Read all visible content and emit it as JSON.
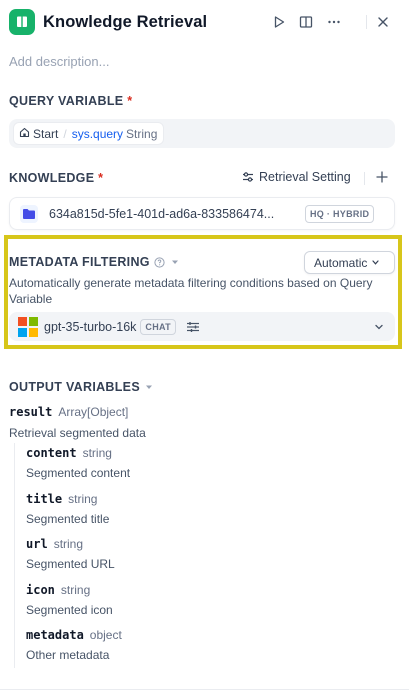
{
  "header": {
    "title": "Knowledge Retrieval",
    "icons": [
      "knowledge-book-icon",
      "play-icon",
      "split-panel-icon",
      "more-icon",
      "close-icon"
    ]
  },
  "description_placeholder": "Add description...",
  "query_variable": {
    "title": "QUERY VARIABLE",
    "required_mark": "*",
    "source": "Start",
    "separator": "/",
    "name": "sys.query",
    "type": "String"
  },
  "knowledge": {
    "title": "KNOWLEDGE",
    "required_mark": "*",
    "retrieval_setting_label": "Retrieval Setting",
    "item": {
      "name": "634a815d-5fe1-401d-ad6a-833586474...",
      "badge": "HQ · HYBRID"
    }
  },
  "metadata_filtering": {
    "title": "METADATA FILTERING",
    "mode": "Automatic",
    "description": "Automatically generate metadata filtering conditions based on Query Variable",
    "model": {
      "name": "gpt-35-turbo-16k",
      "badge": "CHAT"
    },
    "highlight_color": "#d7c61a"
  },
  "output_variables": {
    "title": "OUTPUT VARIABLES",
    "result": {
      "name": "result",
      "type": "Array[Object]",
      "description": "Retrieval segmented data"
    },
    "children": [
      {
        "name": "content",
        "type": "string",
        "description": "Segmented content"
      },
      {
        "name": "title",
        "type": "string",
        "description": "Segmented title"
      },
      {
        "name": "url",
        "type": "string",
        "description": "Segmented URL"
      },
      {
        "name": "icon",
        "type": "string",
        "description": "Segmented icon"
      },
      {
        "name": "metadata",
        "type": "object",
        "description": "Other metadata"
      }
    ]
  },
  "colors": {
    "node_icon_bg": "#17b26a",
    "required": "#d92d20",
    "variable_link": "#155eef"
  }
}
